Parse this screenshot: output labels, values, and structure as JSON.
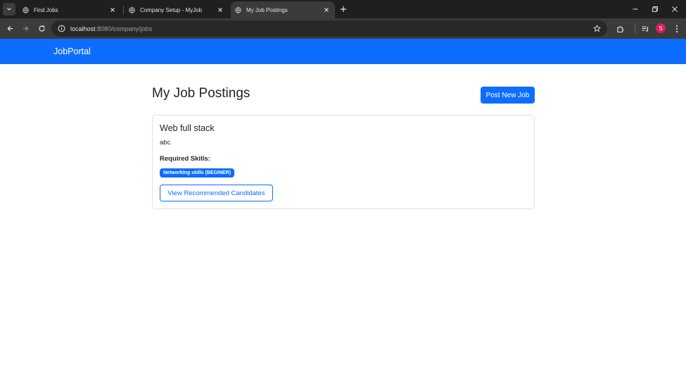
{
  "browser": {
    "tabs": [
      {
        "title": "Find Jobs",
        "active": false
      },
      {
        "title": "Company Setup - MyJob",
        "active": false
      },
      {
        "title": "My Job Postings",
        "active": true
      }
    ],
    "url_host": "localhost",
    "url_path": ":8080/company/jobs",
    "profile_initial": "S"
  },
  "navbar": {
    "brand": "JobPortal",
    "color": "#0d6efd"
  },
  "main": {
    "title": "My Job Postings",
    "post_button_label": "Post New Job"
  },
  "jobs": [
    {
      "title": "Web full stack",
      "description": "abc",
      "skills_heading": "Required Skills:",
      "skills": [
        "Networking skills (BEGINER)"
      ],
      "action_label": "View Recommended Candidates"
    }
  ],
  "icons": {
    "tab_favicon": "globe-icon",
    "back": "back-arrow-icon",
    "forward": "forward-arrow-icon",
    "reload": "reload-icon",
    "site_info": "site-info-icon",
    "bookmark": "star-icon",
    "extensions": "puzzle-icon",
    "media": "media-control-icon",
    "menu": "kebab-menu-icon"
  }
}
